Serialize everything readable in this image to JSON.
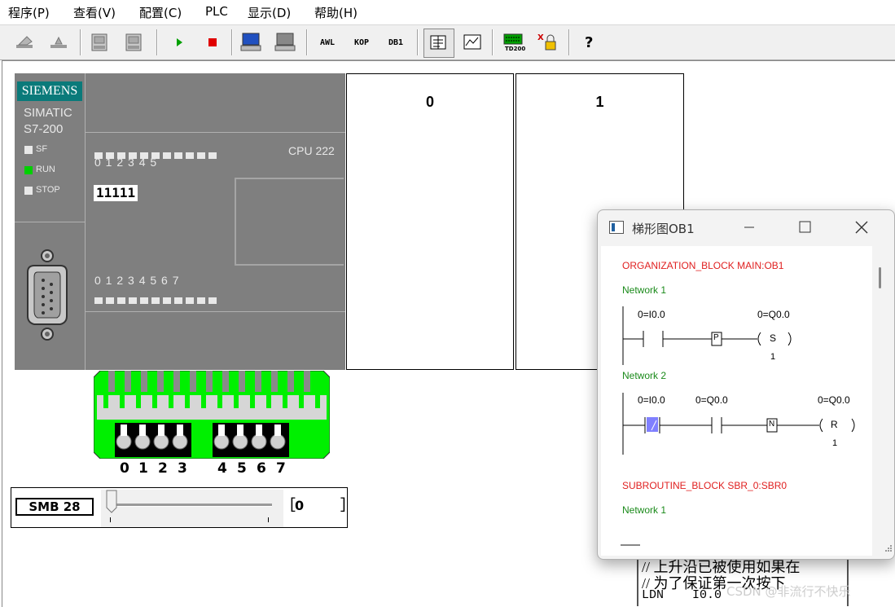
{
  "menu": [
    "程序(P)",
    "查看(V)",
    "配置(C)",
    "PLC",
    "显示(D)",
    "帮助(H)"
  ],
  "toolbar": {
    "awl_label": "AWL",
    "kop_label": "KOP",
    "db1_label": "DB1",
    "td200_label": "TD200"
  },
  "plc": {
    "brand": "SIEMENS",
    "series": "SIMATIC",
    "model": "S7-200",
    "cpu": "CPU 222",
    "status": [
      "SF",
      "RUN",
      "STOP"
    ],
    "input_labels": "0 1 2 3 4 5",
    "output_labels": "0 1 2 3 4 5 6 7",
    "input_state": "11111",
    "run_color": "#00d000"
  },
  "modules": [
    "0",
    "1"
  ],
  "inputs": {
    "numbers_left": [
      "0",
      "1",
      "2",
      "3"
    ],
    "numbers_right": [
      "4",
      "5",
      "6",
      "7"
    ],
    "color": "#00f000"
  },
  "smb": {
    "label": "SMB 28",
    "value": "0",
    "slider_fraction": 0.0
  },
  "ladder": {
    "title": "梯形图OB1",
    "block": "ORGANIZATION_BLOCK MAIN:OB1",
    "network1": {
      "title": "Network 1",
      "addr1": "0=I0.0",
      "addr2": "0=Q0.0",
      "edge": "P",
      "coil": "S",
      "coil_n": "1"
    },
    "network2": {
      "title": "Network 2",
      "addr1": "0=I0.0",
      "addr2": "0=Q0.0",
      "addr3": "0=Q0.0",
      "edge": "N",
      "coil": "R",
      "coil_n": "1"
    },
    "sub_block": "SUBROUTINE_BLOCK SBR_0:SBR0",
    "sub_network1": "Network 1"
  },
  "editor": {
    "line1": "// 上升沿已被使用如果在",
    "line2": "// 为了保证第一次按下",
    "line3_op": "LDN",
    "line3_arg": "I0.0"
  },
  "watermark": "CSDN @非流行不快乐"
}
